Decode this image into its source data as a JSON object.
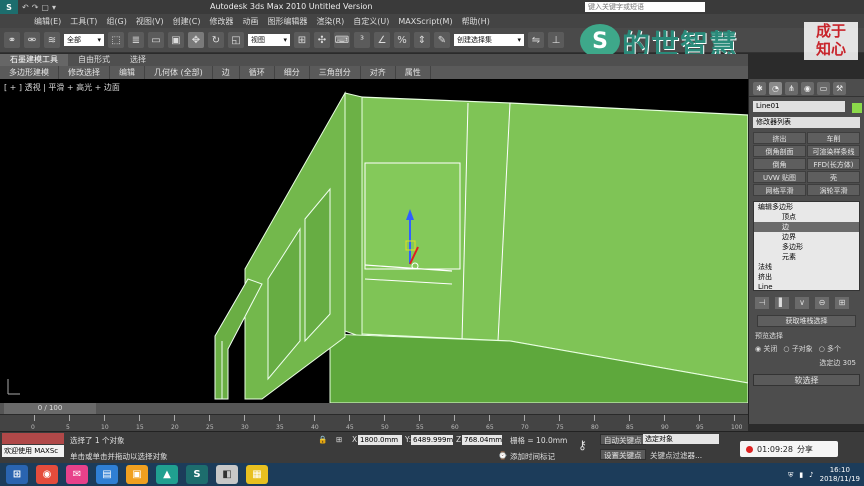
{
  "window": {
    "title": "Autodesk 3ds Max  2010    Untitled Version",
    "search_placeholder": "键入关键字或短语",
    "quick_access": [
      "↶",
      "↷",
      "▢",
      "▾"
    ]
  },
  "menu": [
    "编辑(E)",
    "工具(T)",
    "组(G)",
    "视图(V)",
    "创建(C)",
    "修改器",
    "动画",
    "图形编辑器",
    "渲染(R)",
    "自定义(U)",
    "MAXScript(M)",
    "帮助(H)"
  ],
  "toolbar": {
    "selection_filter": "全部",
    "reference_coord": "视图",
    "named_selection": "创建选择集"
  },
  "watermark": {
    "brand": "的世智慧",
    "seal_lines": [
      "成于",
      "知心"
    ]
  },
  "ribbon": {
    "tabs": [
      "石墨建模工具",
      "自由形式",
      "选择"
    ],
    "active_tab": 0,
    "sub_tabs": [
      "多边形建模",
      "修改选择",
      "编辑",
      "几何体 (全部)",
      "边",
      "循环",
      "细分",
      "三角剖分",
      "对齐",
      "属性"
    ]
  },
  "viewport": {
    "label": "[ + ] 透视 | 平滑 + 高光 + 边面"
  },
  "command_panel": {
    "object_name": "Line01",
    "object_color": "#8bd94a",
    "modifier_list": "修改器列表",
    "modifier_buttons": [
      "挤出",
      "车削",
      "倒角剖面",
      "可渲染样条线",
      "倒角",
      "FFD(长方体)",
      "UVW 贴图",
      "壳",
      "网格平滑",
      "涡轮平滑"
    ],
    "stack": [
      {
        "label": "编辑多边形",
        "indent": 0,
        "selected": false
      },
      {
        "label": "顶点",
        "indent": 1,
        "selected": false
      },
      {
        "label": "边",
        "indent": 1,
        "selected": true
      },
      {
        "label": "边界",
        "indent": 1,
        "selected": false
      },
      {
        "label": "多边形",
        "indent": 1,
        "selected": false
      },
      {
        "label": "元素",
        "indent": 1,
        "selected": false
      },
      {
        "label": "法线",
        "indent": 0,
        "selected": false
      },
      {
        "label": "挤出",
        "indent": 0,
        "selected": false
      },
      {
        "label": "Line",
        "indent": 0,
        "selected": false
      }
    ],
    "get_stack_selection": "获取堆栈选择",
    "preview_selection_label": "预览选择",
    "preview_options": [
      "关闭",
      "子对象",
      "多个"
    ],
    "selected_status": "选定边 305",
    "soft_selection": "软选择"
  },
  "timeline": {
    "frame_display": "0 / 100",
    "ticks": [
      "0",
      "5",
      "10",
      "15",
      "20",
      "25",
      "30",
      "35",
      "40",
      "45",
      "50",
      "55",
      "60",
      "65",
      "70",
      "75",
      "80",
      "85",
      "90",
      "95",
      "100"
    ]
  },
  "status": {
    "welcome": "欢迎使用 MAXSc",
    "selected_count": "选择了 1 个对象",
    "prompt": "单击或单击并拖动以选择对象",
    "x": "1800.0mm",
    "y": "6489.999m",
    "z": "768.04mm",
    "grid": "栅格 = 10.0mm",
    "add_time_tag": "添加时间标记",
    "auto_key": "自动关键点",
    "set_key": "设置关键点",
    "selected_object": "选定对象",
    "key_filters": "关键点过滤器..."
  },
  "recording": {
    "time": "01:09:28",
    "share": "分享"
  },
  "taskbar": {
    "clock_time": "16:10",
    "clock_date": "2018/11/19"
  }
}
